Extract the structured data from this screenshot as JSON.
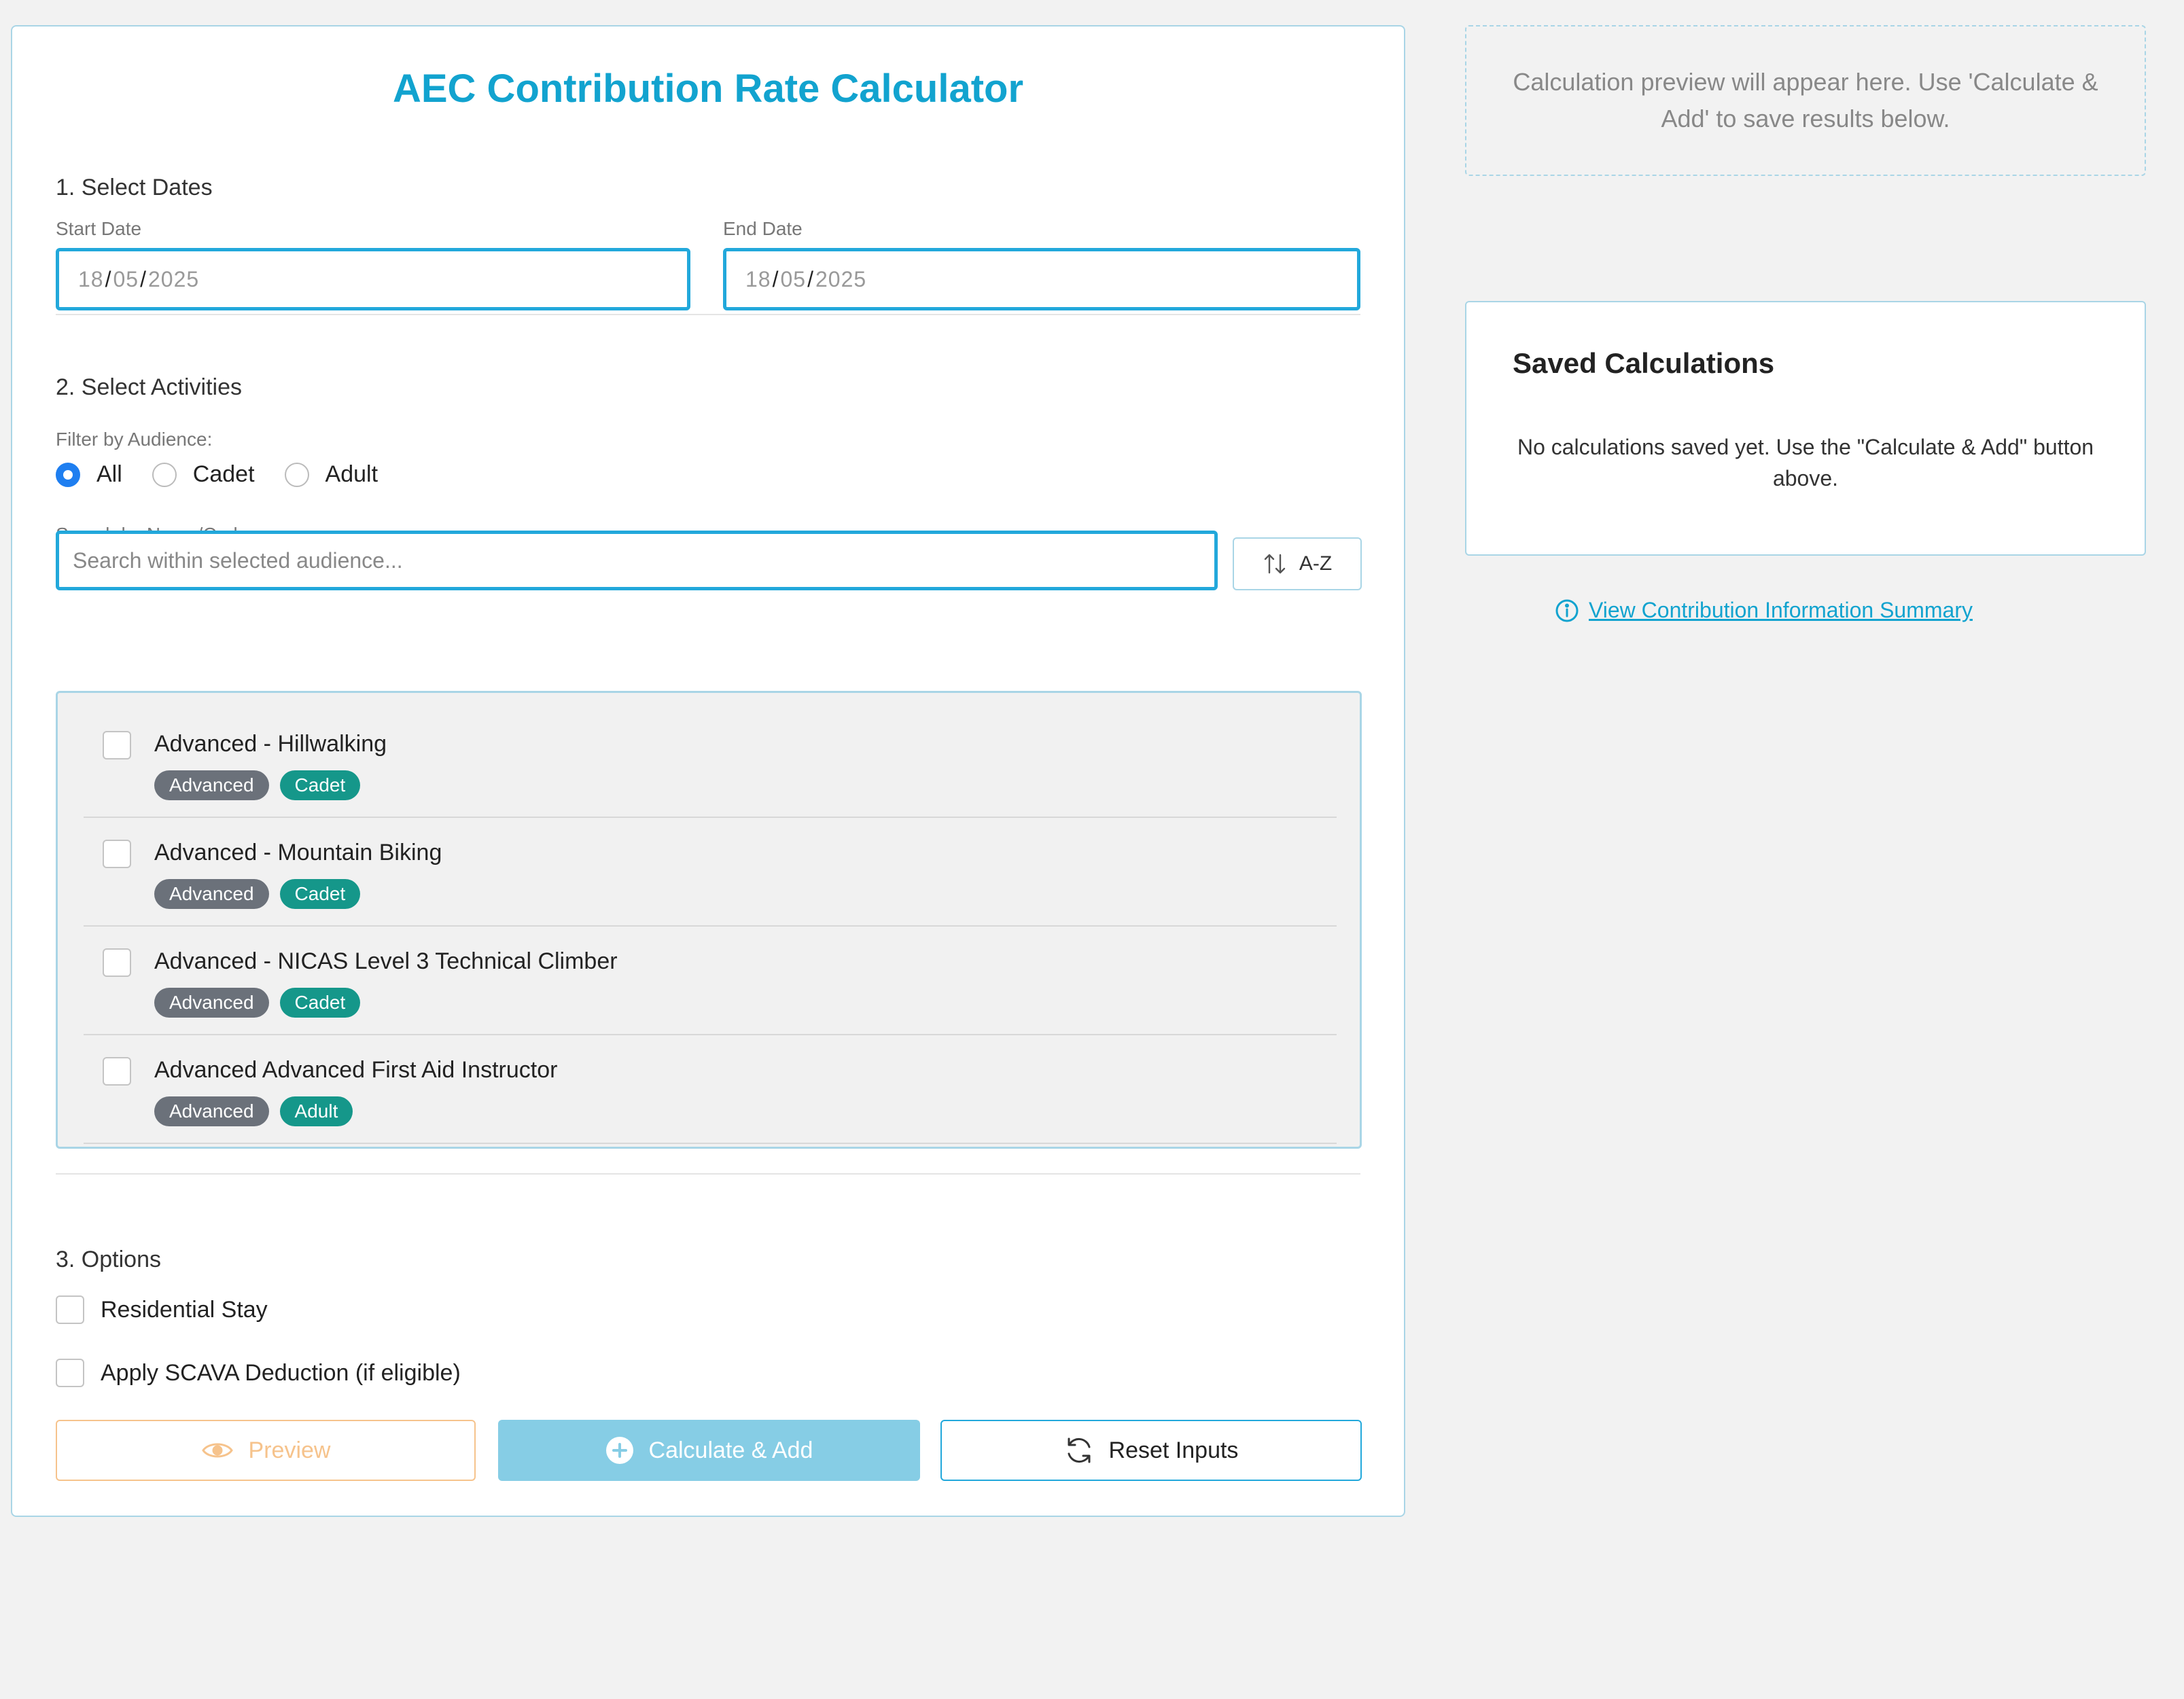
{
  "form": {
    "title": "AEC Contribution Rate Calculator",
    "dates": {
      "section_title": "1. Select Dates",
      "start_label": "Start Date",
      "start_day": "18",
      "start_month": "05",
      "start_year": "2025",
      "end_label": "End Date",
      "end_day": "18",
      "end_month": "05",
      "end_year": "2025"
    },
    "activities": {
      "section_title": "2. Select Activities",
      "filter_label": "Filter by Audience:",
      "filters": [
        {
          "label": "All",
          "checked": true
        },
        {
          "label": "Cadet",
          "checked": false
        },
        {
          "label": "Adult",
          "checked": false
        }
      ],
      "search_label": "Search by Name/Code:",
      "search_placeholder": "Search within selected audience...",
      "sort_label": "A-Z",
      "items": [
        {
          "name": "Advanced - Hillwalking",
          "level": "Advanced",
          "audience": "Cadet"
        },
        {
          "name": "Advanced - Mountain Biking",
          "level": "Advanced",
          "audience": "Cadet"
        },
        {
          "name": "Advanced - NICAS Level 3 Technical Climber",
          "level": "Advanced",
          "audience": "Cadet"
        },
        {
          "name": "Advanced Advanced First Aid Instructor",
          "level": "Advanced",
          "audience": "Adult"
        }
      ]
    },
    "options": {
      "section_title": "3. Options",
      "residential_label": "Residential Stay",
      "scava_label": "Apply SCAVA Deduction (if eligible)"
    },
    "buttons": {
      "preview_label": "Preview",
      "calculate_label": "Calculate & Add",
      "reset_label": "Reset Inputs"
    }
  },
  "preview": {
    "text": "Calculation preview will appear here. Use 'Calculate & Add' to save results below."
  },
  "saved": {
    "title": "Saved Calculations",
    "empty_text": "No calculations saved yet. Use the \"Calculate & Add\" button above."
  },
  "info_link": "View Contribution Information Summary",
  "colors": {
    "accent": "#12a3cf",
    "input_border": "#22a8db",
    "badge_level": "#6b717a",
    "badge_audience": "#15978a",
    "preview_button": "#f6c38c",
    "calculate_button": "#86cde5"
  }
}
